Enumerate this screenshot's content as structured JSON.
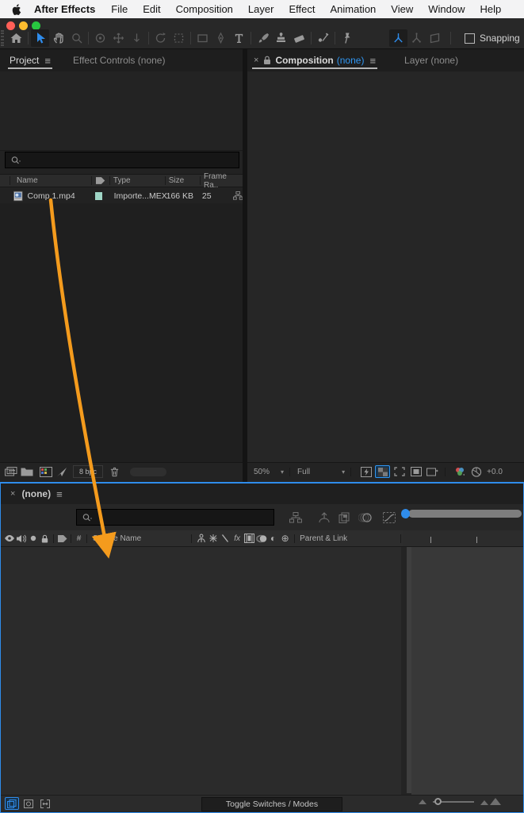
{
  "colors": {
    "accent_blue": "#3097f3",
    "arrow_orange": "#f49b1d",
    "label_teal": "#9fd6c6",
    "traffic_red": "#ff5f57",
    "traffic_yellow": "#febc2e",
    "traffic_green": "#28c840"
  },
  "glyphs": {
    "close": "×",
    "panel_menu": "≡",
    "chevron_down": "▾",
    "hash": "#",
    "fx": "fx",
    "quality": "\\",
    "adjustment_layer": "◐",
    "solo": "●",
    "three_d": "⊕",
    "type_tool": "T"
  },
  "menu_bar": {
    "app_name": "After Effects",
    "items": [
      "File",
      "Edit",
      "Composition",
      "Layer",
      "Effect",
      "Animation",
      "View",
      "Window",
      "Help"
    ]
  },
  "toolbar": {
    "snapping_label": "Snapping"
  },
  "project_panel": {
    "tab_project": "Project",
    "tab_effect_controls": "Effect Controls (none)",
    "search_placeholder": "",
    "columns": {
      "name": "Name",
      "type": "Type",
      "size": "Size",
      "frame_rate": "Frame Ra.."
    },
    "row": {
      "name": "Comp 1.mp4",
      "type": "Importe...MEX",
      "size": "166 KB",
      "frame_rate": "25"
    },
    "footer": {
      "bpc": "8 bpc"
    }
  },
  "viewer_panel": {
    "tab_composition": "Composition",
    "tab_composition_suffix": "(none)",
    "tab_layer": "Layer (none)",
    "footer": {
      "zoom": "50%",
      "resolution": "Full",
      "exposure": "+0.0"
    }
  },
  "timeline_panel": {
    "tab": "(none)",
    "columns": {
      "source_name": "Source Name",
      "parent_link": "Parent & Link"
    },
    "footer": {
      "toggle_label": "Toggle Switches / Modes"
    }
  }
}
